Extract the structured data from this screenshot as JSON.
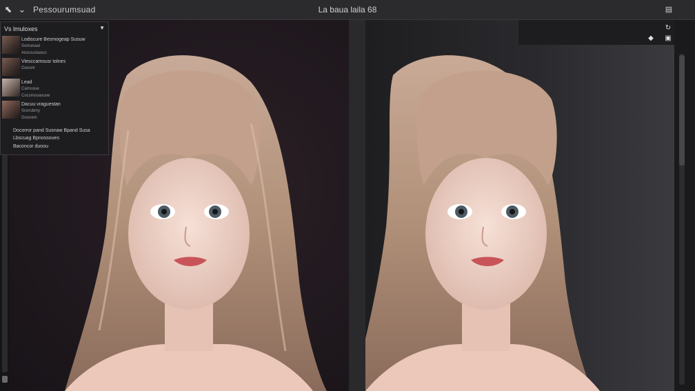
{
  "toolbar": {
    "back_icon": "back-arrow-icon",
    "chevron_icon": "chevron-down-icon",
    "app_title": "Pessourumsuad",
    "doc_title": "La baua laila 68",
    "window_icon": "window-icon"
  },
  "dropdown": {
    "header": "Vs lmuloxes",
    "items": [
      {
        "line1": "Lodiscure Besmogeap Susuw",
        "line2": "Somanaal",
        "line3": "Atocoustaoun"
      },
      {
        "line1": "Viesccamsusr tolnes",
        "line2": "Ouoonr"
      },
      {
        "line1": "Lead",
        "line2": "Camsoue",
        "line3": "Cocsmsoaxuoe"
      },
      {
        "line1": "Dacuu vraguestan",
        "line2": "Scorubmy",
        "line3": "Gosnem"
      }
    ],
    "footer1": "Docorror pand Susnaw Bpand Susa",
    "footer2": "Lbscuag Bpnossoues",
    "footer3": "Baconcor duoou"
  },
  "right_tools": {
    "tool1": "redo-icon",
    "tool2": "copy-icon",
    "tool3": "diamond-icon",
    "tool4": "dot-icon"
  },
  "colors": {
    "panel_left_bg": "#221a20",
    "panel_right_bg": "#2a2a2e",
    "hair": "#b89a88",
    "skin": "#f1d6cb",
    "lips": "#c8545a"
  }
}
